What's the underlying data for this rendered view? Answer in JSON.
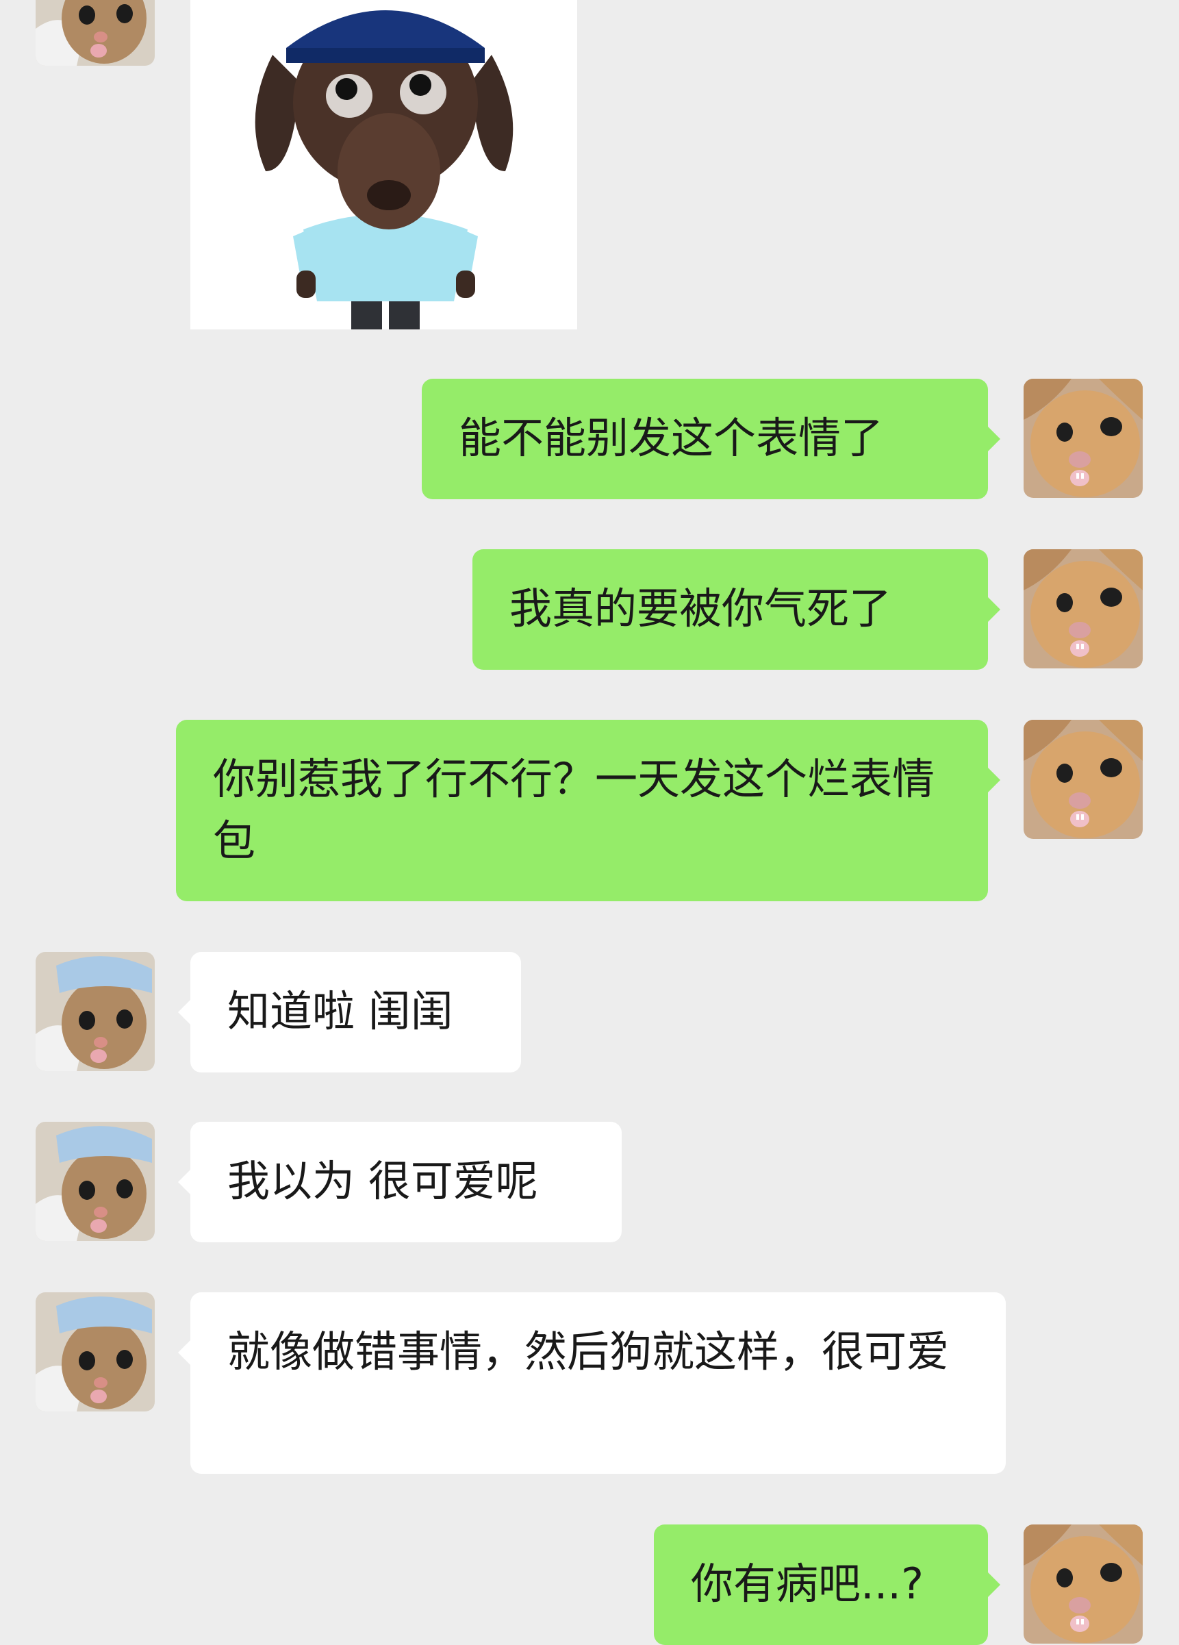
{
  "colors": {
    "background": "#ededed",
    "bubble_incoming": "#ffffff",
    "bubble_outgoing": "#95ec69",
    "text": "#191919"
  },
  "sticker": {
    "icon": "dog-in-cap-sticker"
  },
  "messages": [
    {
      "side": "out",
      "text": "能不能别发这个表情了"
    },
    {
      "side": "out",
      "text": "我真的要被你气死了"
    },
    {
      "side": "out",
      "text": "你别惹我了行不行？一天发这个烂表情包"
    },
    {
      "side": "in",
      "text": "知道啦 闺闺"
    },
    {
      "side": "in",
      "text": "我以为 很可爱呢"
    },
    {
      "side": "in",
      "text": "就像做错事情，然后狗就这样，很可爱"
    },
    {
      "side": "out",
      "text": "你有病吧...?"
    }
  ],
  "avatars": {
    "self_icon": "orange-kitten-avatar",
    "friend_icon": "kitten-with-blue-cap-avatar"
  }
}
